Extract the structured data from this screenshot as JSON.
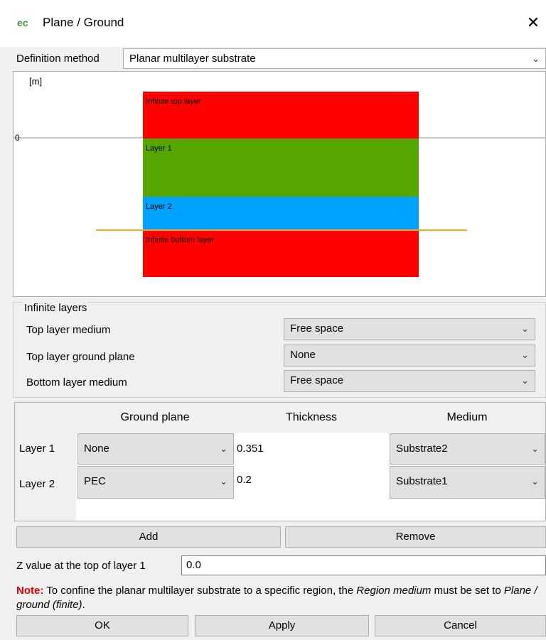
{
  "window": {
    "title": "Plane / Ground",
    "icon_text": "ec",
    "close": "✕"
  },
  "definition": {
    "label": "Definition method",
    "value": "Planar multilayer substrate"
  },
  "preview": {
    "unit": "[m]",
    "zero": "0",
    "layers": [
      {
        "label": "Infinite top layer",
        "color": "#ff0000"
      },
      {
        "label": "Layer 1",
        "color": "#55a600"
      },
      {
        "label": "Layer 2",
        "color": "#00a2ff"
      },
      {
        "label": "Infinite bottom layer",
        "color": "#ff0000"
      }
    ]
  },
  "infinite": {
    "title": "Infinite layers",
    "top_medium_label": "Top layer medium",
    "top_medium_value": "Free space",
    "top_ground_label": "Top layer ground plane",
    "top_ground_value": "None",
    "bottom_medium_label": "Bottom layer medium",
    "bottom_medium_value": "Free space"
  },
  "table": {
    "headers": [
      "Ground plane",
      "Thickness",
      "Medium"
    ],
    "rows": [
      {
        "name": "Layer 1",
        "ground": "None",
        "thickness": "0.351",
        "medium": "Substrate2"
      },
      {
        "name": "Layer 2",
        "ground": "PEC",
        "thickness": "0.2",
        "medium": "Substrate1"
      }
    ]
  },
  "buttons": {
    "add": "Add",
    "remove": "Remove",
    "ok": "OK",
    "apply": "Apply",
    "cancel": "Cancel"
  },
  "zvalue": {
    "label": "Z value at the top of layer 1",
    "value": "0.0"
  },
  "note": {
    "prefix": "Note:",
    "text1": " To confine the planar multilayer substrate to a specific region, the ",
    "em1": "Region medium",
    "text2": " must be set to ",
    "em2": "Plane / ground (finite)",
    "text3": "."
  }
}
